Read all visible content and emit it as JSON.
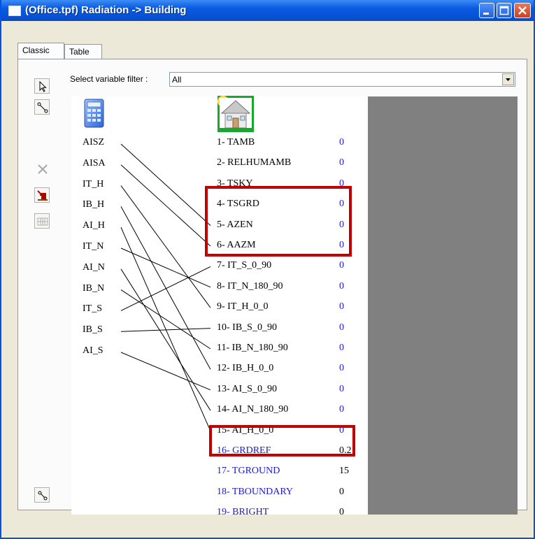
{
  "window": {
    "title": "(Office.tpf) Radiation -> Building",
    "minimize_icon": "minimize-icon",
    "maximize_icon": "maximize-icon",
    "close_icon": "close-icon"
  },
  "tabs": [
    {
      "label": "Classic",
      "active": true
    },
    {
      "label": "Table",
      "active": false
    }
  ],
  "filter": {
    "label": "Select variable filter :",
    "value": "All"
  },
  "toolbar": {
    "icons": [
      "pointer-icon",
      "connect-icon",
      "delete-icon",
      "import-icon",
      "grid-icon",
      "auto-connect-icon"
    ]
  },
  "source": {
    "icon": "calculator-icon",
    "outputs": [
      "AISZ",
      "AISA",
      "IT_H",
      "IB_H",
      "AI_H",
      "IT_N",
      "AI_N",
      "IB_N",
      "IT_S",
      "IB_S",
      "AI_S"
    ]
  },
  "target": {
    "icon": "building-icon",
    "inputs": [
      {
        "label": "1- TAMB",
        "value": "0",
        "connectable": true
      },
      {
        "label": "2- RELHUMAMB",
        "value": "0",
        "connectable": true
      },
      {
        "label": "3- TSKY",
        "value": "0",
        "connectable": true
      },
      {
        "label": "4- TSGRD",
        "value": "0",
        "connectable": true
      },
      {
        "label": "5- AZEN",
        "value": "0",
        "connectable": true
      },
      {
        "label": "6- AAZM",
        "value": "0",
        "connectable": true
      },
      {
        "label": "7- IT_S_0_90",
        "value": "0",
        "connectable": true
      },
      {
        "label": "8- IT_N_180_90",
        "value": "0",
        "connectable": true
      },
      {
        "label": "9- IT_H_0_0",
        "value": "0",
        "connectable": true
      },
      {
        "label": "10- IB_S_0_90",
        "value": "0",
        "connectable": true
      },
      {
        "label": "11- IB_N_180_90",
        "value": "0",
        "connectable": true
      },
      {
        "label": "12- IB_H_0_0",
        "value": "0",
        "connectable": true
      },
      {
        "label": "13- AI_S_0_90",
        "value": "0",
        "connectable": true
      },
      {
        "label": "14- AI_N_180_90",
        "value": "0",
        "connectable": true
      },
      {
        "label": "15- AI_H_0_0",
        "value": "0",
        "connectable": true
      },
      {
        "label": "16- GRDREF",
        "value": "0.2",
        "connectable": false
      },
      {
        "label": "17- TGROUND",
        "value": "15",
        "connectable": false
      },
      {
        "label": "18- TBOUNDARY",
        "value": "0",
        "connectable": false
      },
      {
        "label": "19- BRIGHT",
        "value": "0",
        "connectable": false
      }
    ]
  },
  "connections": [
    {
      "from": "AISZ",
      "to": "5- AZEN"
    },
    {
      "from": "AISA",
      "to": "6- AAZM"
    },
    {
      "from": "IT_H",
      "to": "9- IT_H_0_0"
    },
    {
      "from": "IB_H",
      "to": "12- IB_H_0_0"
    },
    {
      "from": "AI_H",
      "to": "15- AI_H_0_0"
    },
    {
      "from": "IT_N",
      "to": "8- IT_N_180_90"
    },
    {
      "from": "AI_N",
      "to": "14- AI_N_180_90"
    },
    {
      "from": "IB_N",
      "to": "11- IB_N_180_90"
    },
    {
      "from": "IT_S",
      "to": "7- IT_S_0_90"
    },
    {
      "from": "IB_S",
      "to": "10- IB_S_0_90"
    },
    {
      "from": "AI_S",
      "to": "13- AI_S_0_90"
    }
  ],
  "highlights": [
    {
      "name": "highlight-solar-angles",
      "rows": [
        "4- TSGRD",
        "5- AZEN",
        "6- AAZM"
      ],
      "color": "#c00000"
    },
    {
      "name": "highlight-grdref",
      "rows": [
        "16- GRDREF"
      ],
      "color": "#c00000"
    }
  ],
  "colors": {
    "link_label": "#1c1cc8",
    "highlight": "#c00000",
    "title_bar": "#0a5ae0"
  }
}
